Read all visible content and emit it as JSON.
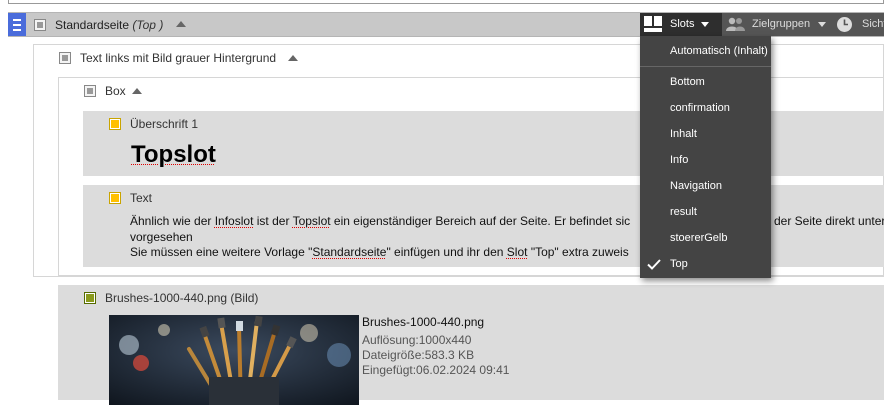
{
  "top_container": {
    "title": "Standardseite",
    "subtitle": "(Top )"
  },
  "toolbar": {
    "slots_label": "Slots",
    "zielgruppen_label": "Zielgruppen",
    "sichtbar_label": "Sichtb"
  },
  "text_block_element": {
    "title": "Text links mit Bild grauer Hintergrund"
  },
  "box_element": {
    "title": "Box"
  },
  "ueberschrift_element": {
    "title": "Überschrift 1",
    "heading": "Topslot"
  },
  "text_element": {
    "title": "Text",
    "line1": {
      "p1": "Ähnlich wie der ",
      "w1": "Infoslot",
      "p2": " ist der ",
      "w2": "Topslot",
      "p3": " ein eigenständiger Bereich auf der Seite. Er befindet sic",
      "p4": "der Seite direkt unter"
    },
    "line2": "vorgesehen",
    "line3": {
      "p1": "Sie müssen eine weitere Vorlage \"",
      "w1": "Standardseite",
      "p2": "\" einfügen und ihr den ",
      "w2": "Slot",
      "p3": " \"Top\" extra zuweis"
    }
  },
  "image_element": {
    "title": "Brushes-1000-440.png (Bild)",
    "file_name": "Brushes-1000-440.png",
    "resolution": "Auflösung:1000x440",
    "file_size": "Dateigröße:583.3 KB",
    "inserted": "Eingefügt:06.02.2024 09:41"
  },
  "slots_dropdown": {
    "items": [
      {
        "label": "Automatisch (Inhalt)",
        "checked": false
      },
      {
        "label": "Bottom",
        "checked": false
      },
      {
        "label": "confirmation",
        "checked": false
      },
      {
        "label": "Inhalt",
        "checked": false
      },
      {
        "label": "Info",
        "checked": false
      },
      {
        "label": "Navigation",
        "checked": false
      },
      {
        "label": "result",
        "checked": false
      },
      {
        "label": "stoererGelb",
        "checked": false
      },
      {
        "label": "Top",
        "checked": true
      }
    ]
  },
  "colors": {
    "handle": "#4a6cdb",
    "dropdown_bg": "#444444",
    "toolbar_bg": "#555555",
    "yellow_checkbox": "#ffc000",
    "image_checkbox": "#8a9a1c"
  },
  "icons": [
    "drag-handle-icon",
    "layout-slots-icon",
    "users-icon",
    "clock-icon",
    "checkmark-icon",
    "caret-up-icon",
    "caret-down-icon"
  ]
}
